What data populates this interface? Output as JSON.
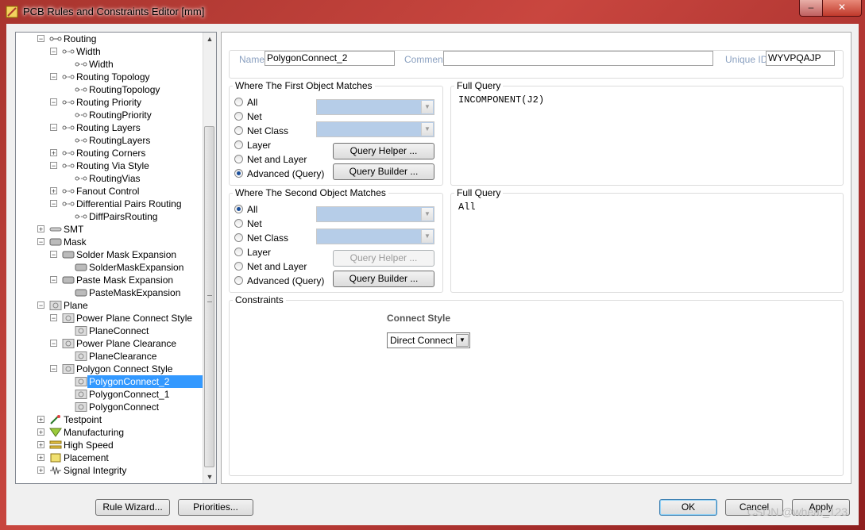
{
  "window": {
    "title": "PCB Rules and Constraints Editor [mm]",
    "minimize_glyph": "–",
    "close_glyph": "✕"
  },
  "tree": {
    "items": [
      {
        "label": "Routing",
        "level": 0,
        "expander": "−",
        "icon": "routing-icon"
      },
      {
        "label": "Width",
        "level": 1,
        "expander": "−",
        "icon": "rule-icon"
      },
      {
        "label": "Width",
        "level": 2,
        "expander": "",
        "icon": "rule-icon"
      },
      {
        "label": "Routing Topology",
        "level": 1,
        "expander": "−",
        "icon": "rule-icon"
      },
      {
        "label": "RoutingTopology",
        "level": 2,
        "expander": "",
        "icon": "rule-icon"
      },
      {
        "label": "Routing Priority",
        "level": 1,
        "expander": "−",
        "icon": "rule-icon"
      },
      {
        "label": "RoutingPriority",
        "level": 2,
        "expander": "",
        "icon": "rule-icon"
      },
      {
        "label": "Routing Layers",
        "level": 1,
        "expander": "−",
        "icon": "rule-icon"
      },
      {
        "label": "RoutingLayers",
        "level": 2,
        "expander": "",
        "icon": "rule-icon"
      },
      {
        "label": "Routing Corners",
        "level": 1,
        "expander": "+",
        "icon": "rule-icon"
      },
      {
        "label": "Routing Via Style",
        "level": 1,
        "expander": "−",
        "icon": "rule-icon"
      },
      {
        "label": "RoutingVias",
        "level": 2,
        "expander": "",
        "icon": "rule-icon"
      },
      {
        "label": "Fanout Control",
        "level": 1,
        "expander": "+",
        "icon": "rule-icon"
      },
      {
        "label": "Differential Pairs Routing",
        "level": 1,
        "expander": "−",
        "icon": "rule-icon"
      },
      {
        "label": "DiffPairsRouting",
        "level": 2,
        "expander": "",
        "icon": "rule-icon"
      },
      {
        "label": "SMT",
        "level": 0,
        "expander": "+",
        "icon": "smt-icon"
      },
      {
        "label": "Mask",
        "level": 0,
        "expander": "−",
        "icon": "mask-icon"
      },
      {
        "label": "Solder Mask Expansion",
        "level": 1,
        "expander": "−",
        "icon": "mask-icon"
      },
      {
        "label": "SolderMaskExpansion",
        "level": 2,
        "expander": "",
        "icon": "mask-icon"
      },
      {
        "label": "Paste Mask Expansion",
        "level": 1,
        "expander": "−",
        "icon": "mask-icon"
      },
      {
        "label": "PasteMaskExpansion",
        "level": 2,
        "expander": "",
        "icon": "mask-icon"
      },
      {
        "label": "Plane",
        "level": 0,
        "expander": "−",
        "icon": "plane-icon"
      },
      {
        "label": "Power Plane Connect Style",
        "level": 1,
        "expander": "−",
        "icon": "plane-icon"
      },
      {
        "label": "PlaneConnect",
        "level": 2,
        "expander": "",
        "icon": "plane-icon"
      },
      {
        "label": "Power Plane Clearance",
        "level": 1,
        "expander": "−",
        "icon": "plane-icon"
      },
      {
        "label": "PlaneClearance",
        "level": 2,
        "expander": "",
        "icon": "plane-icon"
      },
      {
        "label": "Polygon Connect Style",
        "level": 1,
        "expander": "−",
        "icon": "plane-icon"
      },
      {
        "label": "PolygonConnect_2",
        "level": 2,
        "expander": "",
        "icon": "plane-icon",
        "selected": true
      },
      {
        "label": "PolygonConnect_1",
        "level": 2,
        "expander": "",
        "icon": "plane-icon"
      },
      {
        "label": "PolygonConnect",
        "level": 2,
        "expander": "",
        "icon": "plane-icon"
      },
      {
        "label": "Testpoint",
        "level": 0,
        "expander": "+",
        "icon": "testpoint-icon"
      },
      {
        "label": "Manufacturing",
        "level": 0,
        "expander": "+",
        "icon": "manufacturing-icon"
      },
      {
        "label": "High Speed",
        "level": 0,
        "expander": "+",
        "icon": "high-speed-icon"
      },
      {
        "label": "Placement",
        "level": 0,
        "expander": "+",
        "icon": "placement-icon"
      },
      {
        "label": "Signal Integrity",
        "level": 0,
        "expander": "+",
        "icon": "signal-integrity-icon"
      }
    ],
    "scroll_up": "▲",
    "scroll_down": "▼"
  },
  "rule": {
    "name_label": "Name",
    "name_value": "PolygonConnect_2",
    "comment_label": "Comment",
    "comment_value": "",
    "uid_label": "Unique ID",
    "uid_value": "WYVPQAJP"
  },
  "first_match": {
    "title": "Where The First Object Matches",
    "options": [
      "All",
      "Net",
      "Net Class",
      "Layer",
      "Net and Layer",
      "Advanced (Query)"
    ],
    "selected_index": 5,
    "query_helper": "Query Helper ...",
    "query_builder": "Query Builder ...",
    "full_query_label": "Full Query",
    "full_query": "INCOMPONENT(J2)"
  },
  "second_match": {
    "title": "Where The Second Object Matches",
    "options": [
      "All",
      "Net",
      "Net Class",
      "Layer",
      "Net and Layer",
      "Advanced (Query)"
    ],
    "selected_index": 0,
    "query_helper": "Query Helper ...",
    "query_builder": "Query Builder ...",
    "full_query_label": "Full Query",
    "full_query": "All"
  },
  "constraints": {
    "title": "Constraints",
    "connect_style_label": "Connect Style",
    "connect_style_value": "Direct Connect",
    "dropdown_glyph": "▼"
  },
  "footer": {
    "rule_wizard": "Rule Wizard...",
    "priorities": "Priorities...",
    "ok": "OK",
    "cancel": "Cancel",
    "apply": "Apply"
  },
  "watermark": "CSDN @wheat_123",
  "colors": {
    "selection": "#3399ff",
    "combo_disabled": "#b6cde8",
    "field_label": "#8aa0c0"
  }
}
